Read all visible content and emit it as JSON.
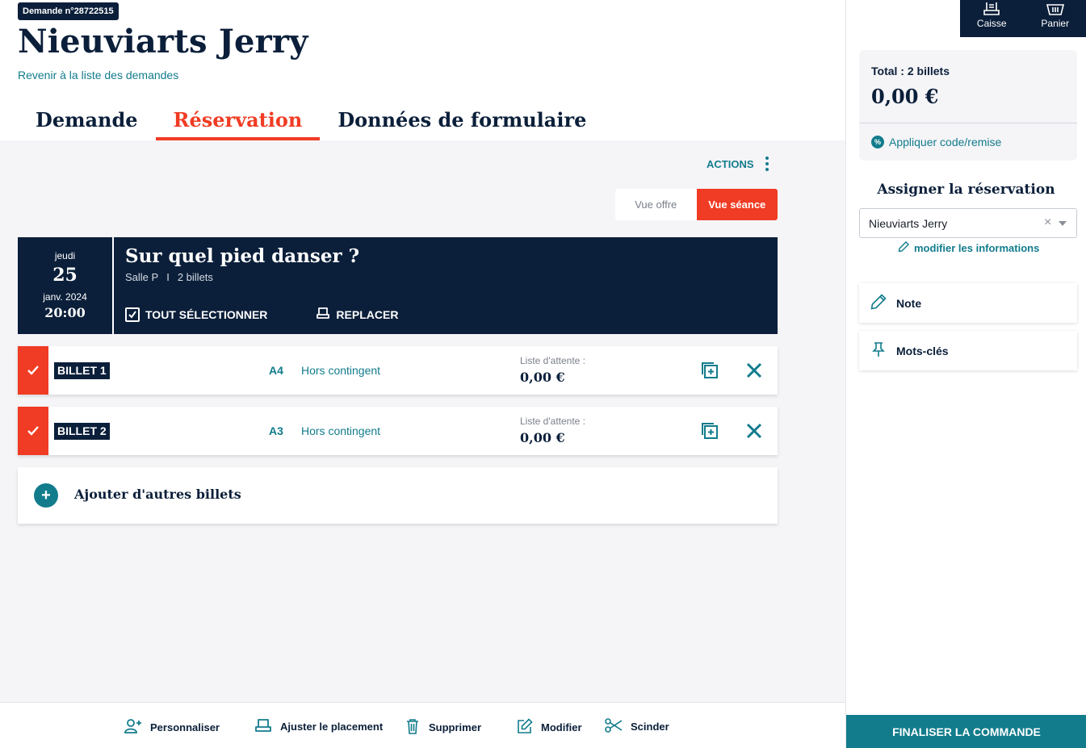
{
  "header": {
    "request_badge": "Demande n°28722515",
    "title": "Nieuviarts Jerry",
    "back_link": "Revenir à la liste des demandes"
  },
  "tabs": [
    {
      "label": "Demande",
      "active": false
    },
    {
      "label": "Réservation",
      "active": true
    },
    {
      "label": "Données de formulaire",
      "active": false
    }
  ],
  "actions_label": "ACTIONS",
  "view_toggle": {
    "offer": "Vue offre",
    "session": "Vue séance",
    "selected": "session"
  },
  "show": {
    "day_name": "jeudi",
    "day_num": "25",
    "month_year": "janv. 2024",
    "time": "20:00",
    "title": "Sur quel pied danser ?",
    "hall": "Salle P",
    "separator": "I",
    "tickets_count": "2 billets",
    "select_all": "TOUT SÉLECTIONNER",
    "replace": "REPLACER"
  },
  "tickets": [
    {
      "label": "BILLET 1",
      "seat": "A4",
      "quota": "Hors contingent",
      "wait_label": "Liste d'attente :",
      "price": "0,00 €",
      "checked": true
    },
    {
      "label": "BILLET 2",
      "seat": "A3",
      "quota": "Hors contingent",
      "wait_label": "Liste d'attente :",
      "price": "0,00 €",
      "checked": true
    }
  ],
  "add_more": {
    "icon": "+",
    "label": "Ajouter d'autres billets"
  },
  "bottom_bar": {
    "personalize": "Personnaliser",
    "adjust": "Ajuster le placement",
    "delete": "Supprimer",
    "edit": "Modifier",
    "split": "Scinder"
  },
  "side": {
    "nav": {
      "cash": "Caisse",
      "cart": "Panier"
    },
    "total_label": "Total : 2 billets",
    "total_amount": "0,00 €",
    "discount_icon": "%",
    "discount_link": "Appliquer code/remise",
    "assign_title": "Assigner la réservation",
    "assign_value": "Nieuviarts Jerry",
    "assign_clear": "×",
    "modify_info": "modifier les informations",
    "note": "Note",
    "keywords": "Mots-clés",
    "finalize": "FINALISER LA COMMANDE"
  },
  "colors": {
    "navy": "#0b1f3a",
    "accent": "#f03c24",
    "teal": "#127c8c",
    "bg": "#f5f4f7"
  }
}
